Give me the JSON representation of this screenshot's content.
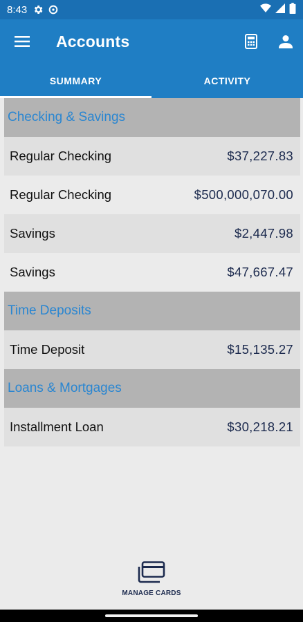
{
  "status": {
    "time": "8:43"
  },
  "header": {
    "title": "Accounts"
  },
  "tabs": [
    {
      "label": "SUMMARY",
      "active": true
    },
    {
      "label": "ACTIVITY",
      "active": false
    }
  ],
  "sections": [
    {
      "title": "Checking & Savings",
      "accounts": [
        {
          "name": "Regular Checking",
          "amount": "$37,227.83"
        },
        {
          "name": "Regular Checking",
          "amount": "$500,000,070.00"
        },
        {
          "name": "Savings",
          "amount": "$2,447.98"
        },
        {
          "name": "Savings",
          "amount": "$47,667.47"
        }
      ]
    },
    {
      "title": "Time Deposits",
      "accounts": [
        {
          "name": "Time Deposit",
          "amount": "$15,135.27"
        }
      ]
    },
    {
      "title": "Loans & Mortgages",
      "accounts": [
        {
          "name": "Installment Loan",
          "amount": "$30,218.21"
        }
      ]
    }
  ],
  "footer": {
    "manage_cards_label": "MANAGE CARDS"
  },
  "colors": {
    "appbar": "#1f7ec4",
    "statusbar": "#1a6fb3",
    "section_header_bg": "#b3b3b3",
    "section_header_text": "#2a86d1",
    "amount_text": "#1c2a4e"
  },
  "icons": [
    "settings-gear-icon",
    "settings-alt-icon",
    "wifi-icon",
    "signal-icon",
    "battery-icon",
    "hamburger-menu-icon",
    "calculator-icon",
    "profile-icon",
    "cards-icon"
  ]
}
